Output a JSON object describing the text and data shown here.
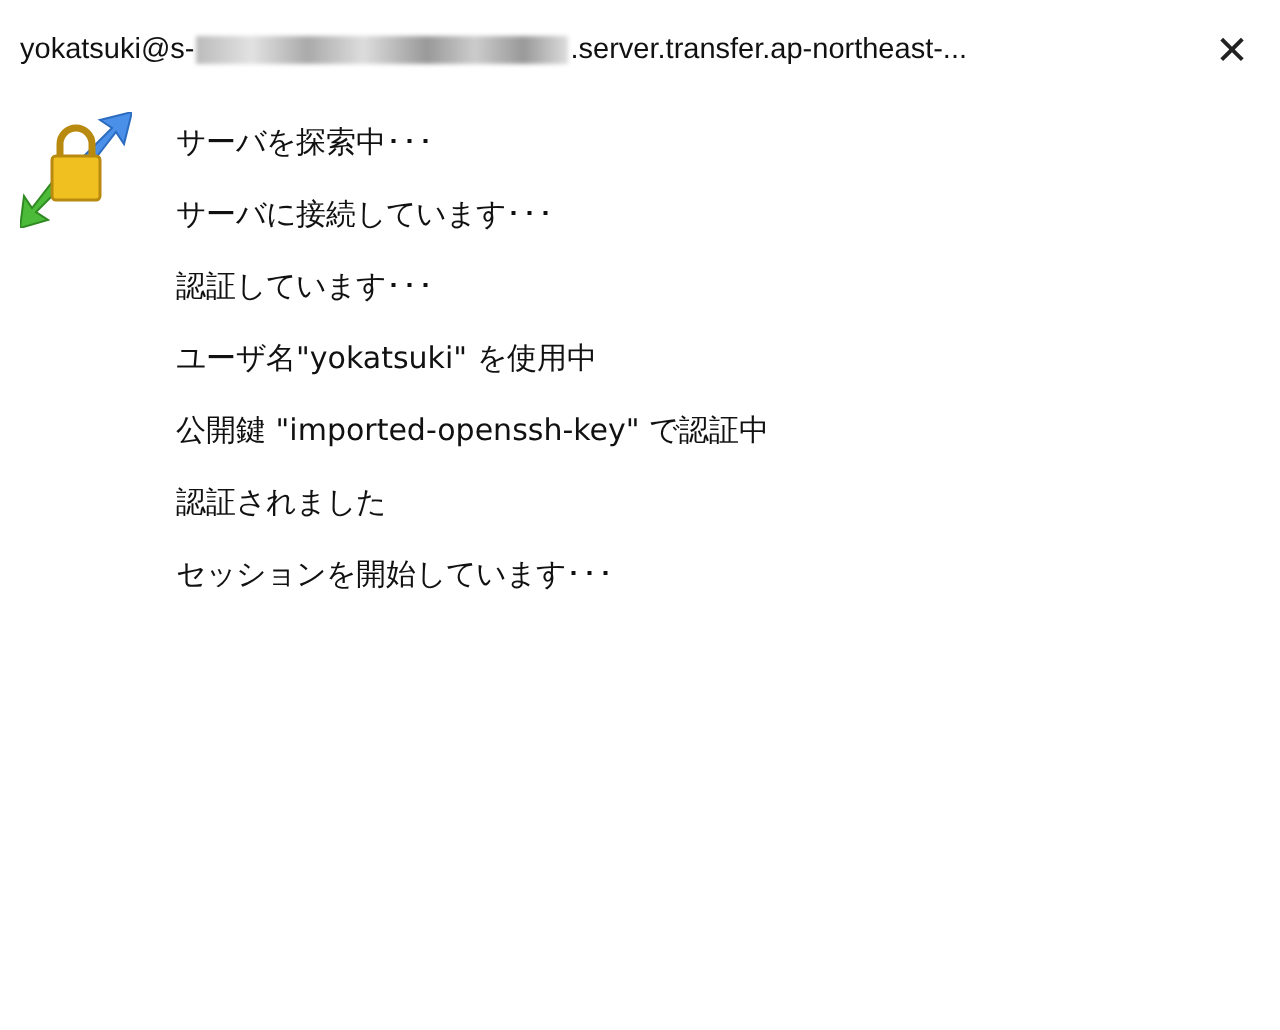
{
  "window": {
    "title_start": "yokatsuki@s-",
    "title_redacted": true,
    "title_end": ".server.transfer.ap-northeast-..."
  },
  "close_button": {
    "label": "✕"
  },
  "messages": [
    "サーバを探索中･･･",
    "サーバに接続しています･･･",
    "認証しています･･･",
    "ユーザ名\"yokatsuki\" を使用中",
    "公開鍵 \"imported-openssh-key\" で認証中",
    "認証されました",
    "セッションを開始しています･･･"
  ]
}
